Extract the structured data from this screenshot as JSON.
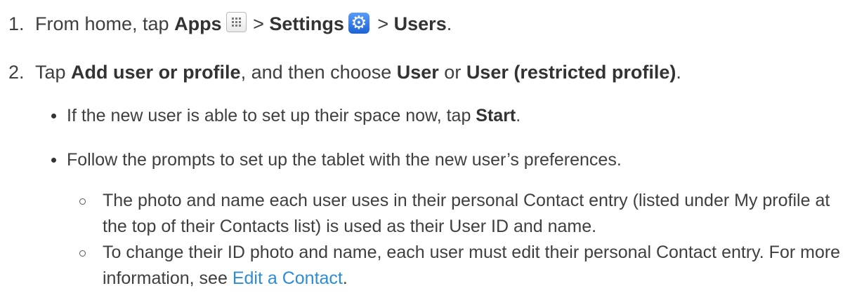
{
  "steps": [
    {
      "number": "1.",
      "parts": [
        "From home, tap ",
        "Apps",
        " > ",
        "Settings",
        " > ",
        "Users",
        "."
      ],
      "icons": [
        "apps-grid-icon",
        "settings-gear-icon"
      ]
    },
    {
      "number": "2.",
      "parts": [
        "Tap ",
        "Add user or profile",
        ", and then choose ",
        "User",
        " or ",
        "User (restricted profile)",
        "."
      ]
    }
  ],
  "bullets": [
    {
      "parts": [
        "If the new user is able to set up their space now, tap ",
        "Start",
        "."
      ]
    },
    {
      "text": "Follow the prompts to set up the tablet with the new user’s preferences."
    }
  ],
  "subbullets": [
    {
      "text": "The photo and name each user uses in their personal Contact entry (listed under My profile at the top of their Contacts list) is used as their User ID and name."
    },
    {
      "parts": [
        "To change their ID photo and name, each user must edit their personal Contact entry. For more information, see ",
        "Edit a Contact",
        "."
      ]
    }
  ],
  "colors": {
    "text": "#3f3f3f",
    "link": "#2e8bd6",
    "settings_icon": "#2f7ae5"
  }
}
